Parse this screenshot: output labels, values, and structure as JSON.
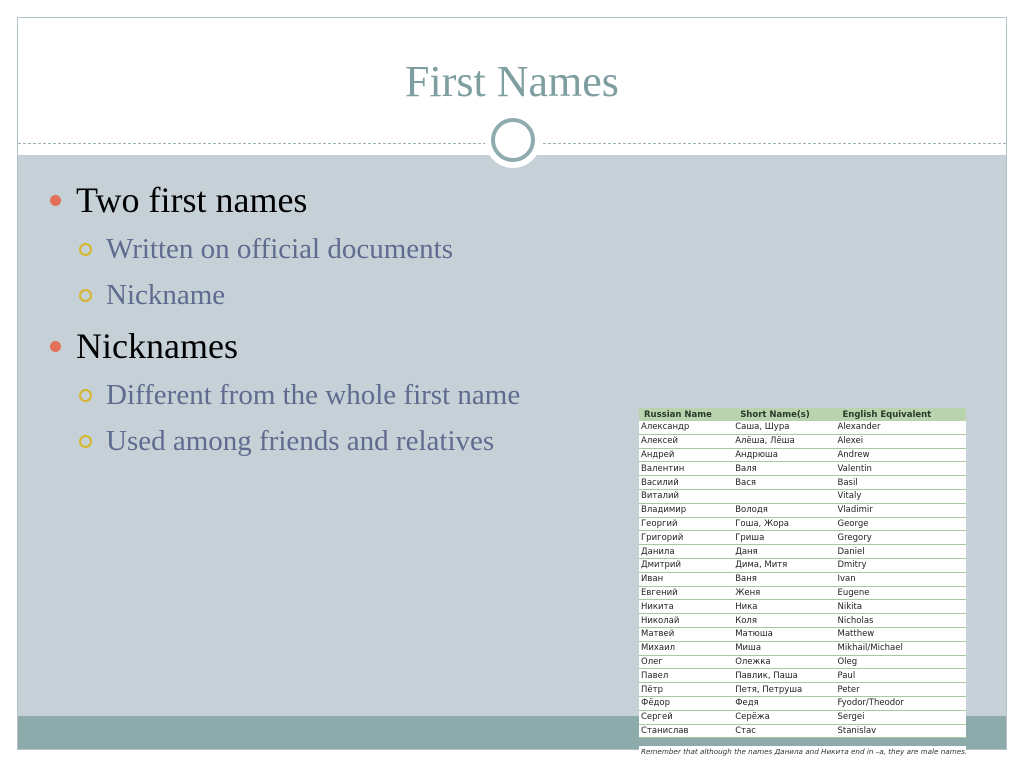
{
  "slide": {
    "title": "First Names",
    "bullets": [
      {
        "text": "Two first names",
        "sub": [
          "Written on official documents",
          "Nickname"
        ]
      },
      {
        "text": "Nicknames",
        "sub": [
          "Different from the whole first name",
          "Used among friends and relatives"
        ]
      }
    ]
  },
  "table": {
    "headers": [
      "Russian Name",
      "Short Name(s)",
      "English Equivalent"
    ],
    "rows": [
      [
        "Александр",
        "Саша, Шура",
        "Alexander"
      ],
      [
        "Алексей",
        "Алёша, Лёша",
        "Alexei"
      ],
      [
        "Андрей",
        "Андрюша",
        "Andrew"
      ],
      [
        "Валентин",
        "Валя",
        "Valentin"
      ],
      [
        "Василий",
        "Вася",
        "Basil"
      ],
      [
        "Виталий",
        "",
        "Vitaly"
      ],
      [
        "Владимир",
        "Володя",
        "Vladimir"
      ],
      [
        "Георгий",
        "Гоша, Жора",
        "George"
      ],
      [
        "Григорий",
        "Гриша",
        "Gregory"
      ],
      [
        "Данила",
        "Даня",
        "Daniel"
      ],
      [
        "Дмитрий",
        "Дима, Митя",
        "Dmitry"
      ],
      [
        "Иван",
        "Ваня",
        "Ivan"
      ],
      [
        "Евгений",
        "Женя",
        "Eugene"
      ],
      [
        "Никита",
        "Ника",
        "Nikita"
      ],
      [
        "Николай",
        "Коля",
        "Nicholas"
      ],
      [
        "Матвей",
        "Матюша",
        "Matthew"
      ],
      [
        "Михаил",
        "Миша",
        "Mikhail/Michael"
      ],
      [
        "Олег",
        "Олежка",
        "Oleg"
      ],
      [
        "Павел",
        "Павлик, Паша",
        "Paul"
      ],
      [
        "Пётр",
        "Петя, Петруша",
        "Peter"
      ],
      [
        "Фёдор",
        "Федя",
        "Fyodor/Theodor"
      ],
      [
        "Сергей",
        "Серёжа",
        "Sergei"
      ],
      [
        "Станислав",
        "Стас",
        "Stanislav"
      ]
    ],
    "note": "Remember that although the names Данила and Никита end in –a, they are male names."
  },
  "colors": {
    "title": "#7e9ea0",
    "background": "#c5d1d7",
    "footer": "#8eabac",
    "bullet_level1": "#e2705a",
    "bullet_level2": "#d7b52a",
    "sub_text": "#5f6b8f",
    "table_header": "#b8d3ae"
  }
}
